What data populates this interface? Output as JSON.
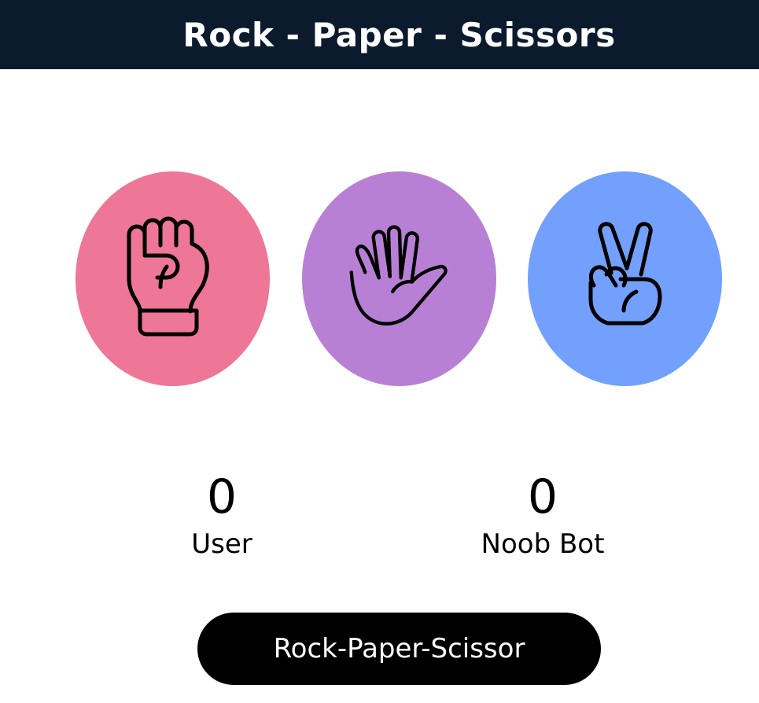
{
  "header": {
    "title": "Rock - Paper - Scissors"
  },
  "choices": [
    {
      "id": "rock",
      "icon": "fist-icon",
      "color": "#ee7696"
    },
    {
      "id": "paper",
      "icon": "open-hand-icon",
      "color": "#b880d5"
    },
    {
      "id": "scissors",
      "icon": "peace-hand-icon",
      "color": "#72a0fc"
    }
  ],
  "scores": {
    "user": {
      "value": "0",
      "label": "User"
    },
    "bot": {
      "value": "0",
      "label": "Noob Bot"
    }
  },
  "action": {
    "label": "Rock-Paper-Scissor"
  }
}
